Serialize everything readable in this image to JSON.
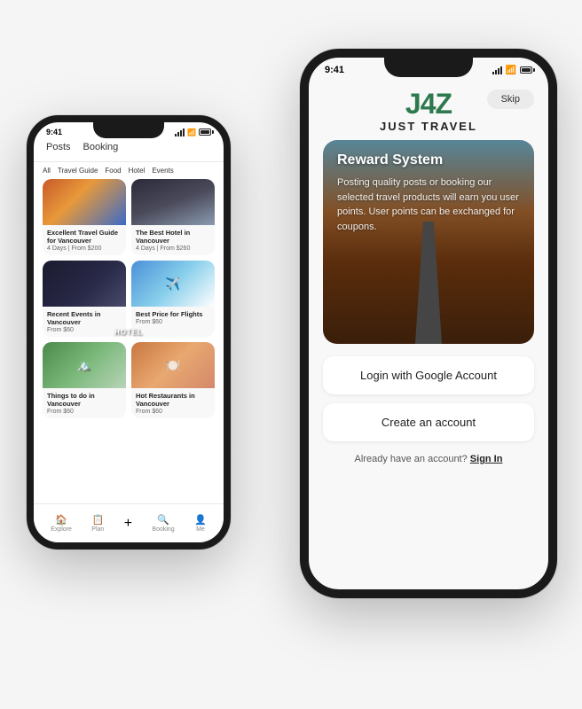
{
  "scene": {
    "background": "#f5f5f5"
  },
  "phone_left": {
    "status_bar": {
      "time": "9:41"
    },
    "nav_tabs": [
      "Posts",
      "Booking"
    ],
    "filter_chips": [
      "All",
      "Travel Guide",
      "Food",
      "Hotel",
      "Events"
    ],
    "cards": [
      {
        "id": "card-1",
        "image_type": "img-vancouver",
        "title": "Excellent Travel Guide for Vancouver",
        "meta": "4 Days  |  From $200"
      },
      {
        "id": "card-2",
        "image_type": "img-hotel",
        "title": "The Best Hotel in Vancouver",
        "meta": "4 Days  |  From $260",
        "overlay": "HOTEL"
      },
      {
        "id": "card-3",
        "image_type": "img-events",
        "title": "Recent Events in Vancouver",
        "meta": "From $60"
      },
      {
        "id": "card-4",
        "image_type": "img-flights",
        "title": "Best Price for Flights",
        "meta": "From $60"
      },
      {
        "id": "card-5",
        "image_type": "img-mountains",
        "title": "Things to do in Vancouver",
        "meta": "From $60"
      },
      {
        "id": "card-6",
        "image_type": "img-food",
        "title": "Hot Restaurants in Vancouver",
        "meta": "From $60"
      }
    ],
    "bottom_nav": [
      {
        "label": "Explore",
        "icon": "🏠"
      },
      {
        "label": "Plan",
        "icon": "📋"
      },
      {
        "label": "+",
        "icon": "+"
      },
      {
        "label": "Booking",
        "icon": "🔍"
      },
      {
        "label": "Me",
        "icon": "👤"
      }
    ]
  },
  "phone_right": {
    "status_bar": {
      "time": "9:41"
    },
    "skip_label": "Skip",
    "logo": "J4Z",
    "tagline": "JUST TRAVEL",
    "reward_card": {
      "title": "Reward System",
      "description": "Posting quality posts or booking our selected travel products will earn you user points. User points can be exchanged for coupons."
    },
    "buttons": {
      "google_login": "Login with Google Account",
      "create_account": "Create an account"
    },
    "signin_text": "Already have an account?",
    "signin_link": "Sign In"
  }
}
